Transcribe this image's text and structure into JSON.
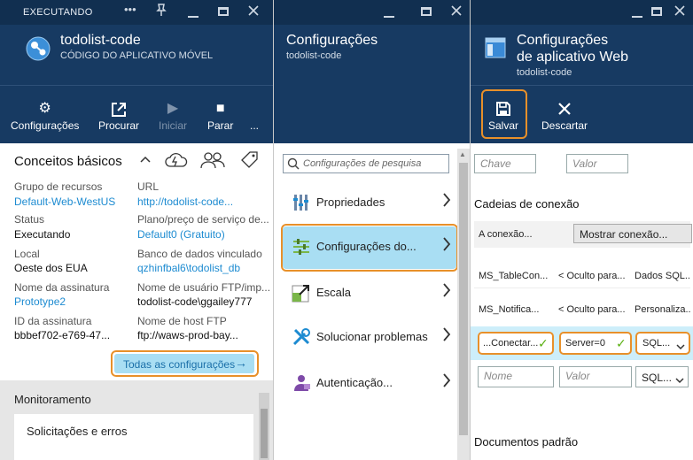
{
  "blade1": {
    "status": "EXECUTANDO",
    "title": "todolist-code",
    "subtitle": "CÓDIGO DO APLICATIVO MÓVEL",
    "commands": {
      "settings": "Configurações",
      "browse": "Procurar",
      "start": "Iniciar",
      "stop": "Parar",
      "more": "..."
    },
    "essentials": {
      "title": "Conceitos básicos",
      "resource_group_label": "Grupo de recursos",
      "resource_group_value": "Default-Web-WestUS",
      "url_label": "URL",
      "url_value": "http://todolist-code...",
      "status_label": "Status",
      "status_value": "Executando",
      "plan_label": "Plano/preço de serviço de...",
      "plan_value": "Default0 (Gratuito)",
      "location_label": "Local",
      "location_value": "Oeste dos EUA",
      "db_label": "Banco de dados vinculado",
      "db_value": "qzhinfbal6\\todolist_db",
      "subscription_label": "Nome da assinatura",
      "subscription_value": "Prototype2",
      "ftp_user_label": "Nome de usuário FTP/imp...",
      "ftp_user_value": "todolist-code\\ggailey777",
      "subscription_id_label": "ID da assinatura",
      "subscription_id_value": "bbbef702-e769-47...",
      "ftp_host_label": "Nome de host FTP",
      "ftp_host_value": "ftp://waws-prod-bay...",
      "all_settings": "Todas as configurações"
    },
    "monitoring": {
      "title": "Monitoramento",
      "tile": "Solicitações e erros"
    }
  },
  "blade2": {
    "title": "Configurações",
    "subtitle": "todolist-code",
    "search_placeholder": "Configurações de pesquisa",
    "items": [
      {
        "label": "Propriedades",
        "icon": "properties-icon"
      },
      {
        "label": "Configurações do...",
        "icon": "app-settings-icon"
      },
      {
        "label": "Escala",
        "icon": "scale-icon"
      },
      {
        "label": "Solucionar problemas",
        "icon": "troubleshoot-icon"
      },
      {
        "label": "Autenticação...",
        "icon": "auth-icon"
      }
    ]
  },
  "blade3": {
    "title_line1": "Configurações",
    "title_line2": "de aplicativo Web",
    "subtitle": "todolist-code",
    "save": "Salvar",
    "discard": "Descartar",
    "key_placeholder": "Chave",
    "value_placeholder": "Valor",
    "conn_title": "Cadeias de conexão",
    "conn_label": "A conexão...",
    "show_conn": "Mostrar conexão...",
    "rows": [
      {
        "name": "MS_TableCon...",
        "value": "< Oculto para...",
        "type": "Dados SQL..."
      },
      {
        "name": "MS_Notifica...",
        "value": "< Oculto para...",
        "type": "Personaliza..."
      }
    ],
    "new_row": {
      "name": "...Conectar...",
      "value": "Server=0",
      "type": "SQL..."
    },
    "empty_row": {
      "name_placeholder": "Nome",
      "value_placeholder": "Valor",
      "type": "SQL..."
    },
    "default_docs": "Documentos padrão"
  }
}
